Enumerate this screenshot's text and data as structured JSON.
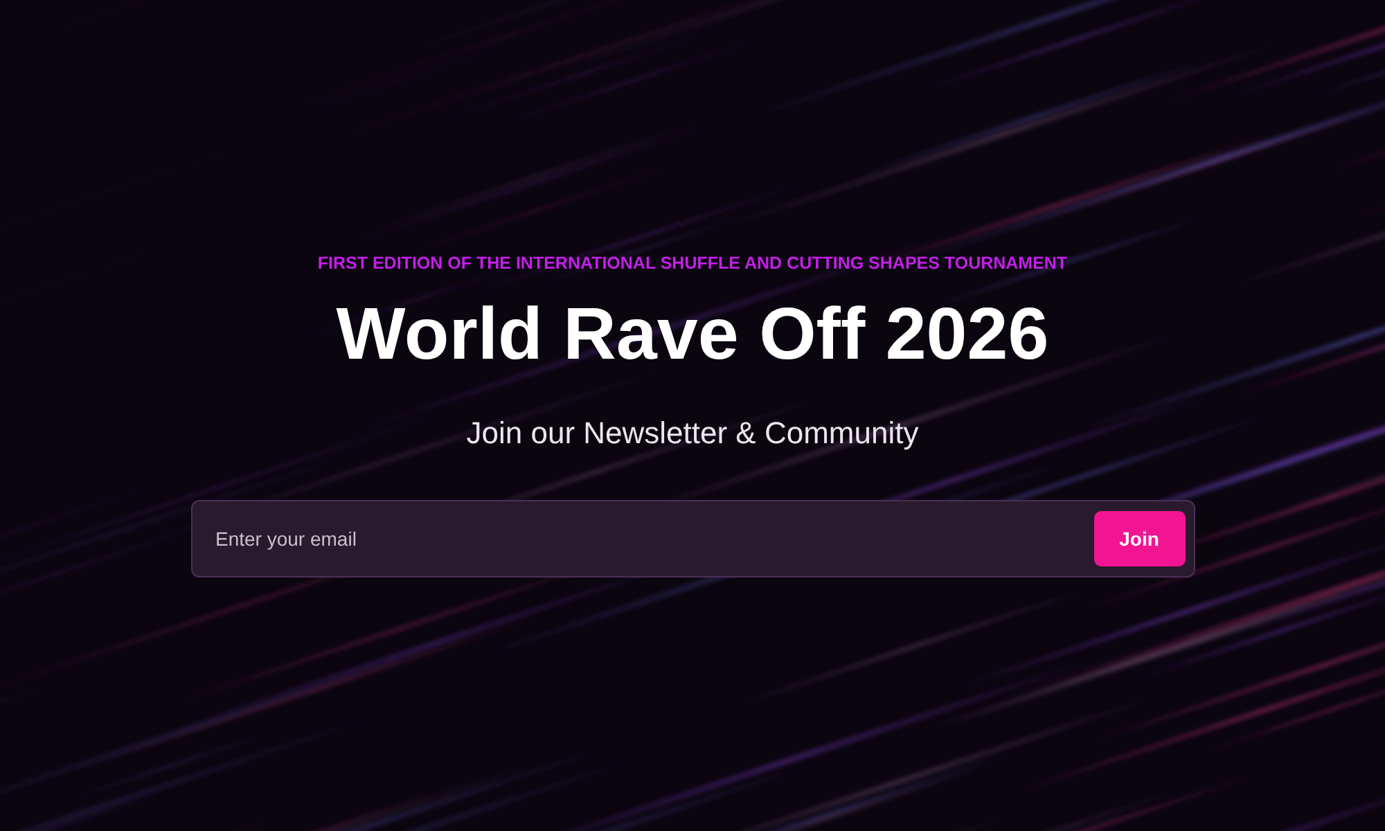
{
  "hero": {
    "eyebrow": "FIRST EDITION OF THE INTERNATIONAL SHUFFLE AND CUTTING SHAPES TOURNAMENT",
    "title": "World Rave Off 2026",
    "subtitle": "Join our Newsletter & Community"
  },
  "signup_form": {
    "email_field": {
      "placeholder": "Enter your email"
    },
    "submit_button": "Join"
  }
}
